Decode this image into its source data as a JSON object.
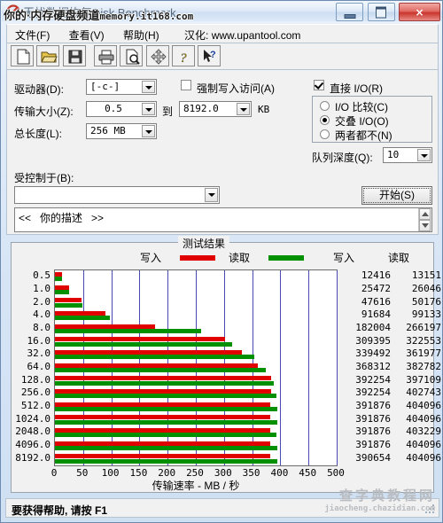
{
  "window": {
    "title": "无忧数据恢复Disk Benchmark",
    "title_watermark_cn": "你的·内存硬盘频道",
    "title_watermark_en": "memory.it168.com",
    "buttons": {
      "minimize": "minimize-button",
      "maximize": "maximize-button",
      "close": "×"
    }
  },
  "menu": {
    "items": [
      "文件(F)",
      "查看(V)",
      "帮助(H)"
    ],
    "note": "汉化: www.upantool.com"
  },
  "toolbar": {
    "buttons": [
      "new-icon",
      "open-icon",
      "save-icon",
      "print-icon",
      "print-preview-icon",
      "move-icon",
      "about-icon",
      "help-cursor-icon"
    ]
  },
  "settings": {
    "drive_label": "驱动器(D):",
    "drive_value": "[-c-]",
    "blocksize_label": "传输大小(Z):",
    "blocksize_from": "0.5",
    "to_label": "到",
    "blocksize_to": "8192.0",
    "unit_label": "KB",
    "length_label": "总长度(L):",
    "length_value": "256 MB",
    "force_write_label": "强制写入访问(A)",
    "force_write_checked": false,
    "direct_io_label": "直接 I/O(R)",
    "direct_io_checked": true,
    "io_options": [
      {
        "label": "I/O 比较(C)",
        "selected": false
      },
      {
        "label": "交叠 I/O(O)",
        "selected": true
      },
      {
        "label": "两者都不(N)",
        "selected": false
      }
    ],
    "queue_depth_label": "队列深度(Q):",
    "queue_depth_value": "10",
    "controlled_by_label": "受控制于(B):",
    "controlled_by_value": "",
    "description_text": "<<   你的描述   >>",
    "start_button": "开始(S)"
  },
  "results": {
    "group_title": "测试结果",
    "legend": [
      {
        "label": "写入",
        "color": "#e00000"
      },
      {
        "label": "读取",
        "color": "#009000"
      }
    ],
    "col_head_write": "写入",
    "col_head_read": "读取"
  },
  "chart_data": {
    "type": "bar",
    "title": "测试结果",
    "orientation": "horizontal",
    "xlabel": "传输速率 - MB / 秒",
    "ylabel": "",
    "xlim": [
      0,
      500
    ],
    "xticks": [
      0,
      50,
      100,
      150,
      200,
      250,
      300,
      350,
      400,
      450,
      500
    ],
    "grid": true,
    "legend_position": "top",
    "categories": [
      "0.5",
      "1.0",
      "2.0",
      "4.0",
      "8.0",
      "16.0",
      "32.0",
      "64.0",
      "128.0",
      "256.0",
      "512.0",
      "1024.0",
      "2048.0",
      "4096.0",
      "8192.0"
    ],
    "series": [
      {
        "name": "写入",
        "color": "#e00000",
        "unit": "KB/s",
        "values_kb": [
          12416,
          25472,
          47616,
          91684,
          182004,
          309395,
          339492,
          368312,
          392254,
          392254,
          391876,
          391876,
          391876,
          391876,
          390654
        ],
        "values_mb": [
          12.1,
          24.9,
          46.5,
          89.5,
          177.7,
          302.1,
          331.5,
          359.7,
          383.1,
          383.1,
          382.7,
          382.7,
          382.7,
          382.7,
          381.5
        ]
      },
      {
        "name": "读取",
        "color": "#009000",
        "unit": "KB/s",
        "values_kb": [
          13151,
          26046,
          50176,
          99133,
          266197,
          322553,
          361977,
          382782,
          397109,
          402743,
          404096,
          404096,
          403229,
          404096,
          404096
        ],
        "values_mb": [
          12.8,
          25.4,
          49.0,
          96.8,
          259.9,
          315.0,
          353.5,
          373.8,
          387.8,
          393.3,
          394.6,
          394.6,
          393.8,
          394.6,
          394.6
        ]
      }
    ]
  },
  "statusbar": {
    "text": "要获得帮助, 请按 F1",
    "watermark_cn": "查字典教程网",
    "watermark_en": "jiaocheng.chazidian.com"
  }
}
